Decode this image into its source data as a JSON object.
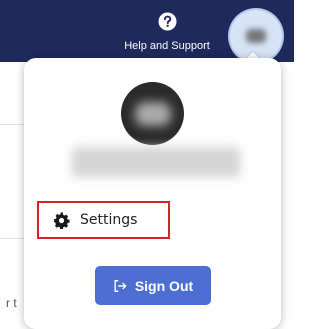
{
  "header": {
    "help_label": "Help and Support",
    "help_icon": "question-circle-icon",
    "avatar_icon": "user-avatar"
  },
  "background_page": {
    "snippet_text": "r t"
  },
  "account_menu": {
    "avatar_icon": "user-avatar-large",
    "user_name_visible": "",
    "items": [
      {
        "label": "Settings",
        "icon": "gear-icon",
        "highlighted": true
      }
    ],
    "sign_out": {
      "label": "Sign Out",
      "icon": "sign-out-icon"
    }
  },
  "colors": {
    "header_bg": "#1f2a5c",
    "sign_out_bg": "#4d6fd4",
    "highlight_border": "#d8232a"
  }
}
